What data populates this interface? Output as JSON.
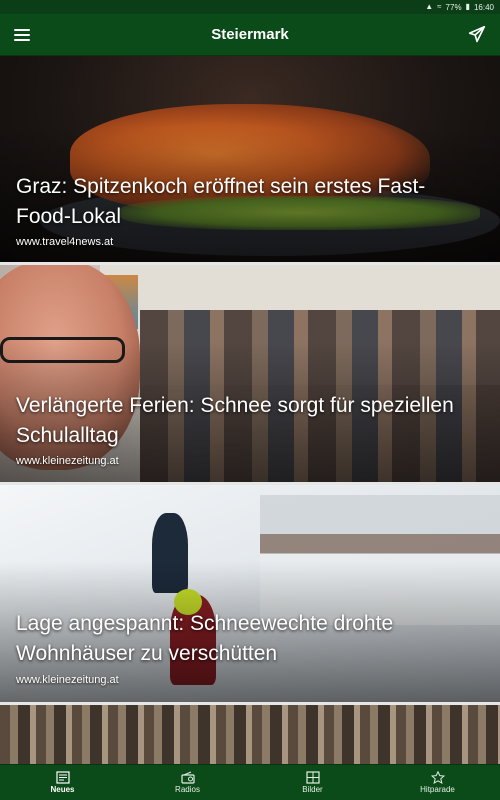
{
  "status_bar": {
    "battery": "77%",
    "time": "16:40"
  },
  "app_bar": {
    "title": "Steiermark"
  },
  "articles": [
    {
      "title": "Graz: Spitzenkoch eröffnet sein erstes Fast-Food-Lokal",
      "source": "www.travel4news.at"
    },
    {
      "title": "Verlängerte Ferien: Schnee sorgt für speziellen Schulalltag",
      "source": "www.kleinezeitung.at"
    },
    {
      "title": "Lage angespannt: Schneewechte drohte Wohnhäuser zu verschütten",
      "source": "www.kleinezeitung.at"
    }
  ],
  "bottom_nav": [
    {
      "label": "Neues",
      "icon": "newspaper-icon",
      "active": true
    },
    {
      "label": "Radios",
      "icon": "radio-icon",
      "active": false
    },
    {
      "label": "Bilder",
      "icon": "gallery-icon",
      "active": false
    },
    {
      "label": "Hitparade",
      "icon": "star-icon",
      "active": false
    }
  ],
  "colors": {
    "app_bar": "#0b4a19",
    "status_bar": "#0b3d16",
    "divider": "#e6e6e6"
  }
}
